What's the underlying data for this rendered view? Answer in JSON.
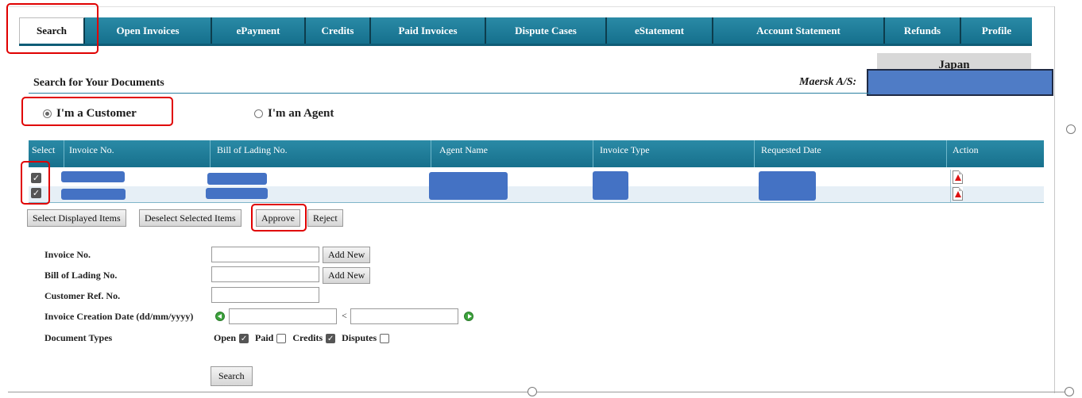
{
  "tabs": [
    {
      "label": "Search",
      "active": true
    },
    {
      "label": "Open Invoices"
    },
    {
      "label": "ePayment"
    },
    {
      "label": "Credits"
    },
    {
      "label": "Paid Invoices"
    },
    {
      "label": "Dispute Cases"
    },
    {
      "label": "eStatement"
    },
    {
      "label": "Account Statement"
    },
    {
      "label": "Refunds"
    },
    {
      "label": "Profile"
    }
  ],
  "country": "Japan",
  "section_title": "Search for Your Documents",
  "company_label": "Maersk A/S:",
  "role": {
    "customer_label": "I'm a Customer",
    "agent_label": "I'm an Agent",
    "selected": "customer"
  },
  "table": {
    "columns": [
      "Select",
      "Invoice No.",
      "Bill of Lading No.",
      "Agent Name",
      "Invoice Type",
      "Requested Date",
      "Action"
    ],
    "rows": [
      {
        "checked": true,
        "action_icon": "pdf-icon"
      },
      {
        "checked": true,
        "action_icon": "pdf-icon"
      }
    ]
  },
  "actions": {
    "select_displayed": "Select Displayed Items",
    "deselect_selected": "Deselect Selected Items",
    "approve": "Approve",
    "reject": "Reject"
  },
  "form": {
    "invoice_no_label": "Invoice No.",
    "bol_label": "Bill of Lading No.",
    "customer_ref_label": "Customer Ref. No.",
    "creation_date_label": "Invoice Creation Date (dd/mm/yyyy)",
    "doc_types_label": "Document Types",
    "add_new": "Add New",
    "date_separator": "<",
    "doc_types": [
      {
        "label": "Open",
        "checked": true
      },
      {
        "label": "Paid",
        "checked": false
      },
      {
        "label": "Credits",
        "checked": true
      },
      {
        "label": "Disputes",
        "checked": false
      }
    ],
    "search_button": "Search"
  },
  "colors": {
    "tab_blue": "#1b7c99",
    "highlight_red": "#e00000",
    "redaction_blue": "#4472c4"
  }
}
